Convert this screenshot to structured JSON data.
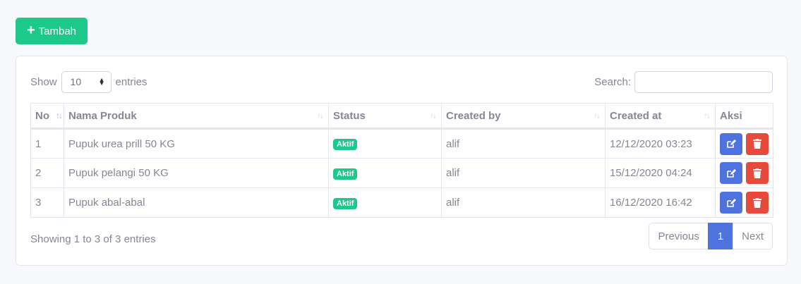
{
  "toolbar": {
    "add_label": "Tambah",
    "add_icon": "plus-icon"
  },
  "length": {
    "show_label": "Show",
    "value": "10",
    "entries_label": "entries"
  },
  "search": {
    "label": "Search:",
    "value": "",
    "placeholder": ""
  },
  "table": {
    "headers": [
      "No",
      "Nama Produk",
      "Status",
      "Created by",
      "Created at",
      "Aksi"
    ],
    "rows": [
      {
        "no": "1",
        "name": "Pupuk urea prill 50 KG",
        "status": "Aktif",
        "created_by": "alif",
        "created_at": "12/12/2020 03:23"
      },
      {
        "no": "2",
        "name": "Pupuk pelangi 50 KG",
        "status": "Aktif",
        "created_by": "alif",
        "created_at": "15/12/2020 04:24"
      },
      {
        "no": "3",
        "name": "Pupuk abal-abal",
        "status": "Aktif",
        "created_by": "alif",
        "created_at": "16/12/2020 16:42"
      }
    ]
  },
  "footer": {
    "info": "Showing 1 to 3 of 3 entries",
    "previous": "Previous",
    "current_page": "1",
    "next": "Next"
  },
  "colors": {
    "success": "#1cc88a",
    "primary": "#4e73df",
    "danger": "#e74a3b",
    "text": "#858796"
  }
}
